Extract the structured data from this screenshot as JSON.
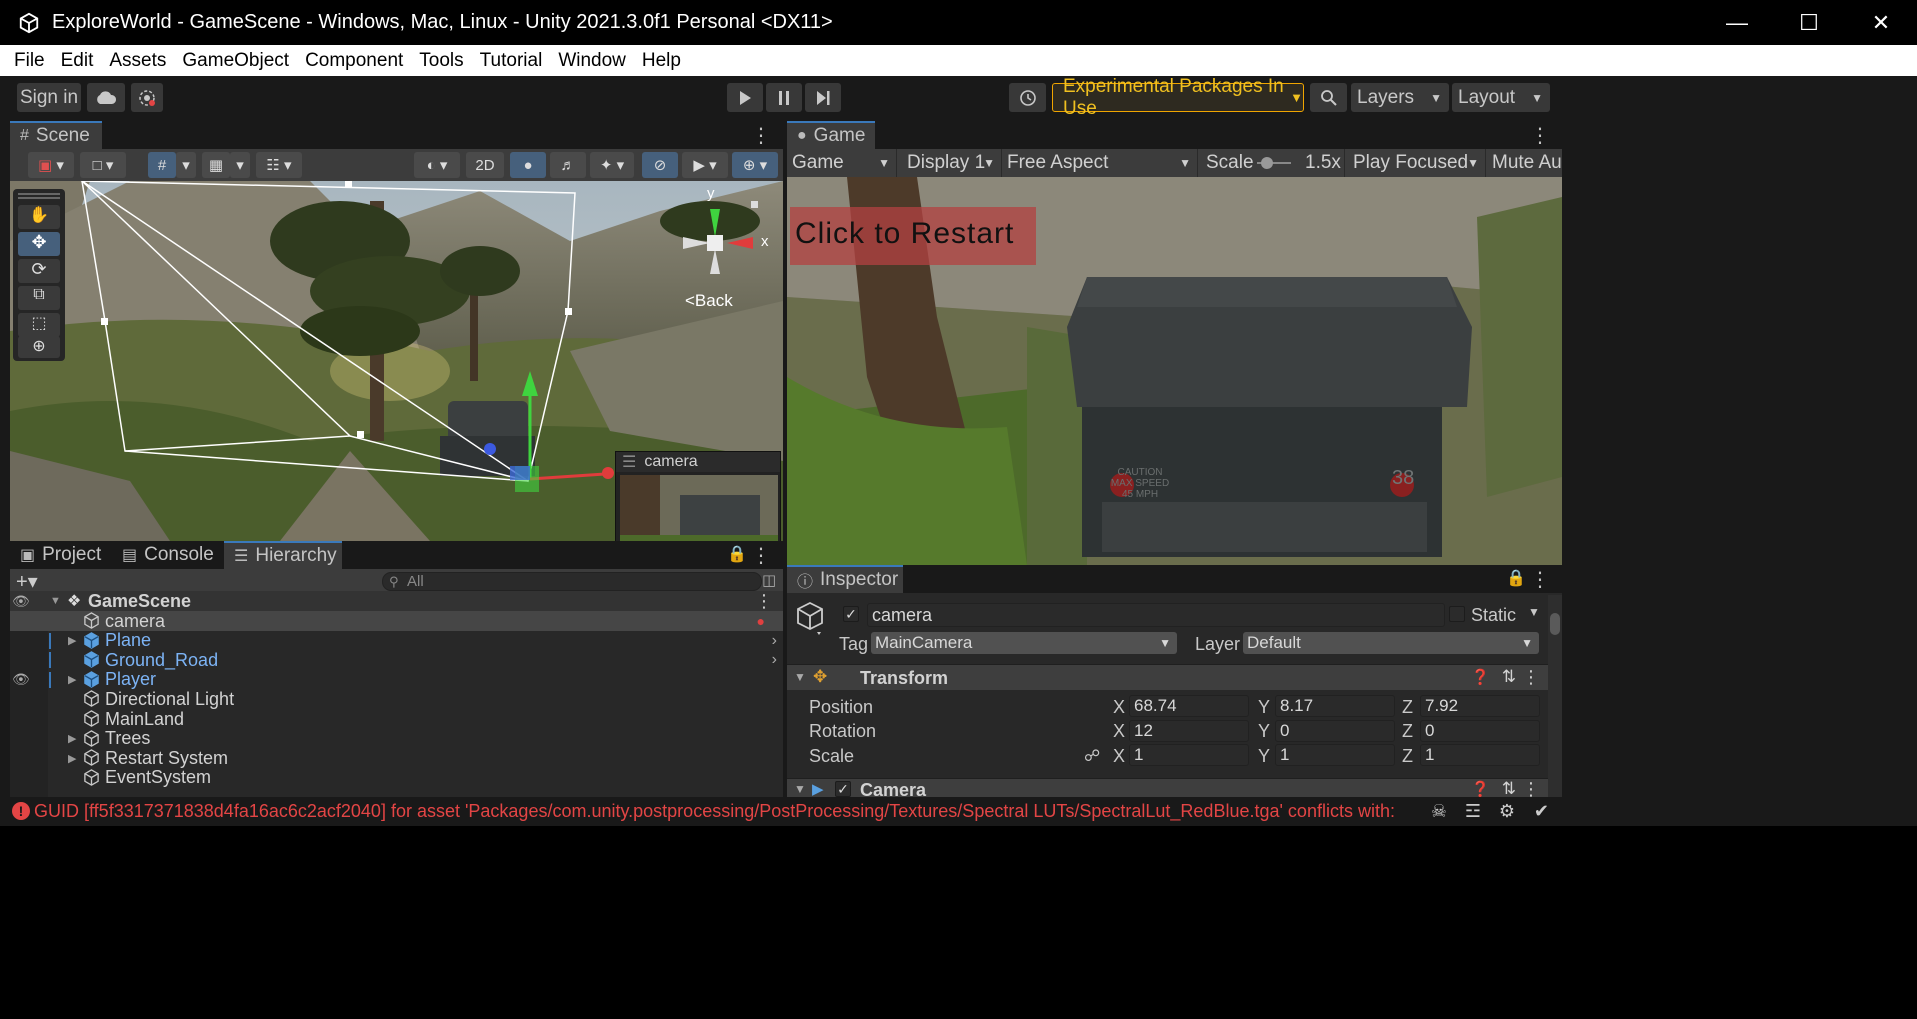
{
  "window": {
    "title": "ExploreWorld - GameScene - Windows, Mac, Linux - Unity 2021.3.0f1 Personal <DX11>",
    "minimize_icon": "minimize-icon",
    "maximize_icon": "maximize-icon",
    "close_icon": "close-icon"
  },
  "menu": [
    "File",
    "Edit",
    "Assets",
    "GameObject",
    "Component",
    "Tools",
    "Tutorial",
    "Window",
    "Help"
  ],
  "toolbar": {
    "sign_in": "Sign in",
    "experimental": "Experimental Packages In Use",
    "layers": "Layers",
    "layout": "Layout"
  },
  "scene": {
    "tab": "Scene",
    "toggle_2d": "2D",
    "gizmo_axes": {
      "y": "y",
      "x": "x"
    },
    "back_label": "<Back",
    "camera_preview_title": "camera"
  },
  "game": {
    "tab": "Game",
    "view_select": "Game",
    "display": "Display 1",
    "aspect": "Free Aspect",
    "scale_label": "Scale",
    "scale_value": "1.5x",
    "play_mode": "Play Focused",
    "mute": "Mute Aud",
    "restart_text": "Click to Restart",
    "truck_text": "CAUTION\nMAX SPEED\n45 MPH",
    "truck_number": "38"
  },
  "bottom_tabs": {
    "project": "Project",
    "console": "Console",
    "hierarchy": "Hierarchy"
  },
  "hierarchy": {
    "search_placeholder": "All",
    "scene_name": "GameScene",
    "items": [
      {
        "label": "camera",
        "prefab": false,
        "foldout": false,
        "selected": true
      },
      {
        "label": "Plane",
        "prefab": true,
        "foldout": true,
        "selected": false
      },
      {
        "label": "Ground_Road",
        "prefab": true,
        "foldout": false,
        "selected": false
      },
      {
        "label": "Player",
        "prefab": true,
        "foldout": true,
        "selected": false
      },
      {
        "label": "Directional Light",
        "prefab": false,
        "foldout": false,
        "selected": false
      },
      {
        "label": "MainLand",
        "prefab": false,
        "foldout": false,
        "selected": false
      },
      {
        "label": "Trees",
        "prefab": false,
        "foldout": true,
        "selected": false
      },
      {
        "label": "Restart System",
        "prefab": false,
        "foldout": true,
        "selected": false
      },
      {
        "label": "EventSystem",
        "prefab": false,
        "foldout": false,
        "selected": false
      }
    ]
  },
  "inspector": {
    "tab": "Inspector",
    "object_name": "camera",
    "static_label": "Static",
    "tag_label": "Tag",
    "tag_value": "MainCamera",
    "layer_label": "Layer",
    "layer_value": "Default",
    "transform_title": "Transform",
    "position_label": "Position",
    "rotation_label": "Rotation",
    "scale_label": "Scale",
    "axis_x": "X",
    "axis_y": "Y",
    "axis_z": "Z",
    "position": {
      "x": "68.74",
      "y": "8.17",
      "z": "7.92"
    },
    "rotation": {
      "x": "12",
      "y": "0",
      "z": "0"
    },
    "scale": {
      "x": "1",
      "y": "1",
      "z": "1"
    },
    "camera_title": "Camera"
  },
  "status": {
    "error": "GUID [ff5f3317371838d4fa16ac6c2acf2040] for asset 'Packages/com.unity.postprocessing/PostProcessing/Textures/Spectral LUTs/SpectralLut_RedBlue.tga' conflicts with:"
  },
  "colors": {
    "accent_blue": "#3a79bb",
    "prefab_blue": "#7cb3f5",
    "error_red": "#e34545",
    "experimental_orange": "#f0a500"
  }
}
